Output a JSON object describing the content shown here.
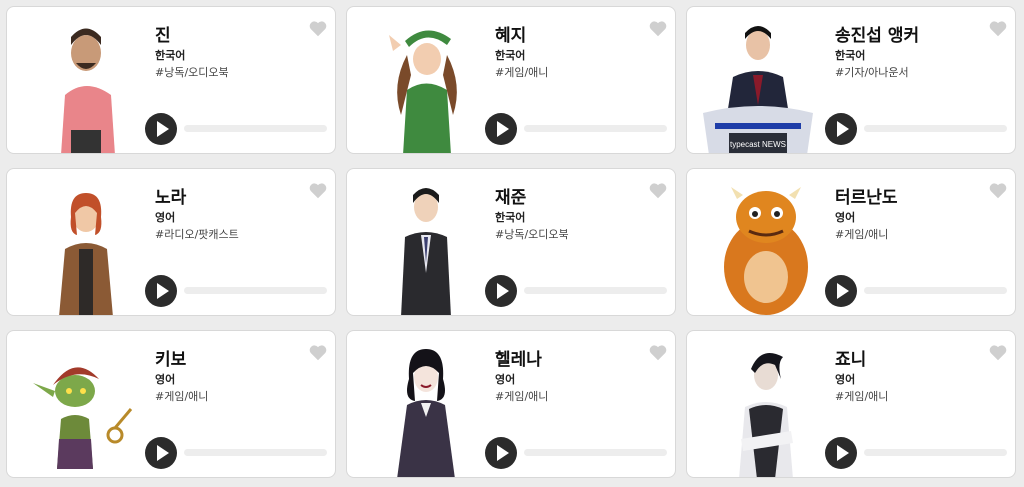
{
  "voices": [
    {
      "name": "진",
      "language": "한국어",
      "tag": "#낭독/오디오북",
      "progress": 0
    },
    {
      "name": "혜지",
      "language": "한국어",
      "tag": "#게임/애니",
      "progress": 0
    },
    {
      "name": "송진섭 앵커",
      "language": "한국어",
      "tag": "#기자/아나운서",
      "progress": 0,
      "badge": "typecast NEWS"
    },
    {
      "name": "노라",
      "language": "영어",
      "tag": "#라디오/팟캐스트",
      "progress": 0
    },
    {
      "name": "재준",
      "language": "한국어",
      "tag": "#낭독/오디오북",
      "progress": 0
    },
    {
      "name": "터르난도",
      "language": "영어",
      "tag": "#게임/애니",
      "progress": 0
    },
    {
      "name": "키보",
      "language": "영어",
      "tag": "#게임/애니",
      "progress": 0
    },
    {
      "name": "헬레나",
      "language": "영어",
      "tag": "#게임/애니",
      "progress": 0
    },
    {
      "name": "죠니",
      "language": "영어",
      "tag": "#게임/애니",
      "progress": 0
    }
  ],
  "icons": {
    "favorite": "heart-icon",
    "play": "play-icon"
  },
  "colors": {
    "favorite": "#cfcfcf",
    "play": "#2b2b2b",
    "progress_track": "#ededed"
  }
}
